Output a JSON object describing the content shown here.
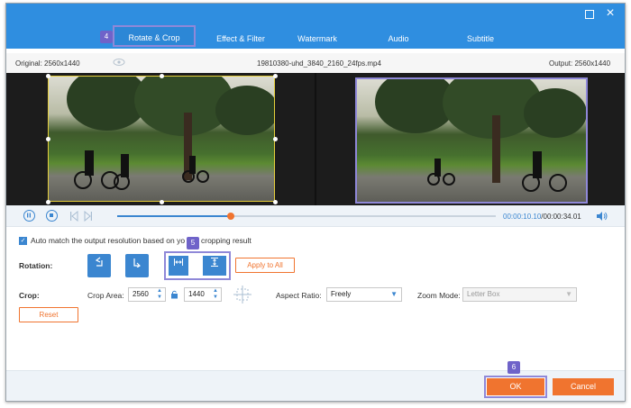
{
  "tabs": [
    {
      "label": "Rotate & Crop",
      "active": true
    },
    {
      "label": "Effect & Filter"
    },
    {
      "label": "Watermark"
    },
    {
      "label": "Audio"
    },
    {
      "label": "Subtitle"
    }
  ],
  "badges": {
    "tab_step": "4",
    "flip_step": "5",
    "ok_step": "6"
  },
  "info": {
    "original": "Original: 2560x1440",
    "filename": "19810380-uhd_3840_2160_24fps.mp4",
    "output": "Output: 2560x1440"
  },
  "player": {
    "current_time": "00:00:10.10",
    "total_time": "/00:00:34.01",
    "progress_fraction": 0.3
  },
  "auto_match": {
    "checked": true,
    "label_visible": "Auto match the output resolution based on yo",
    "label_hidden_tail": "cropping result"
  },
  "rotation": {
    "label": "Rotation:",
    "apply_all": "Apply to All",
    "icons": [
      "rotate-left-icon",
      "rotate-right-icon",
      "flip-horizontal-icon",
      "flip-vertical-icon"
    ]
  },
  "crop": {
    "label": "Crop:",
    "area_label": "Crop Area:",
    "width": "2560",
    "height": "1440",
    "aspect_label": "Aspect Ratio:",
    "aspect_value": "Freely",
    "zoom_label": "Zoom Mode:",
    "zoom_value": "Letter Box",
    "reset": "Reset"
  },
  "footer": {
    "ok": "OK",
    "cancel": "Cancel"
  },
  "colors": {
    "accent_blue": "#2f8ee0",
    "orange": "#f0742f",
    "highlight_purple": "#8f88d8",
    "crop_yellow": "#e6cf3b"
  }
}
